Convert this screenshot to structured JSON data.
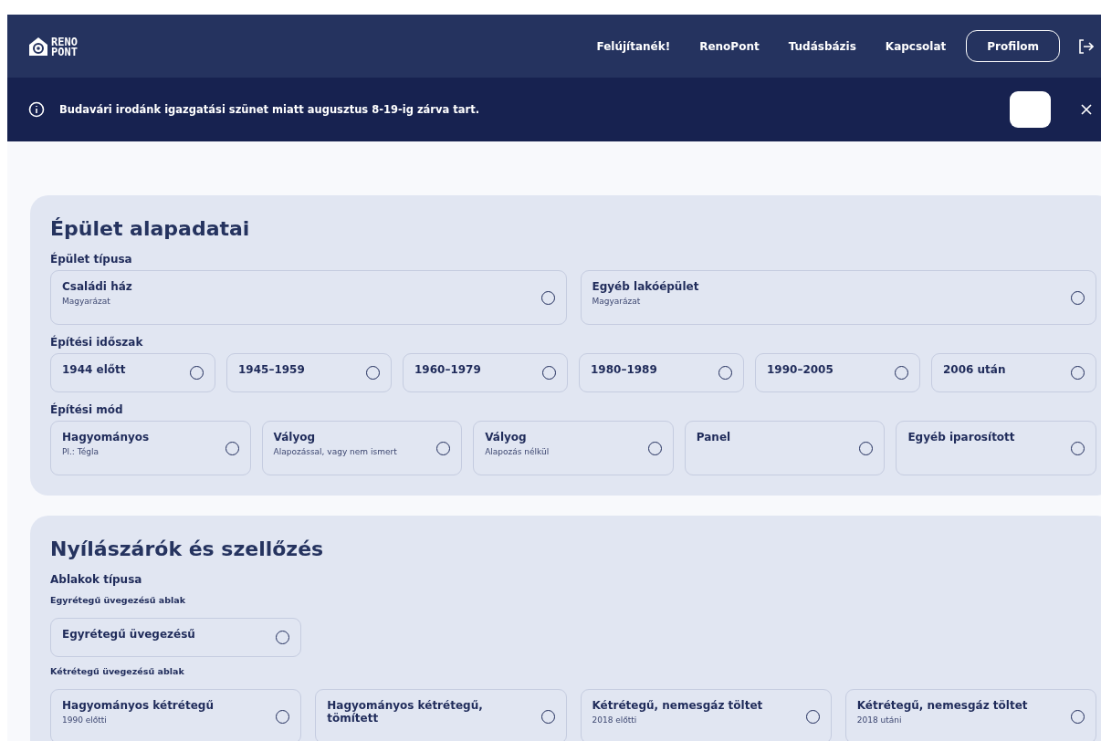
{
  "header": {
    "logo": [
      "RENO",
      "PONT"
    ],
    "nav": [
      "Felújítanék!",
      "RenoPont",
      "Tudásbázis",
      "Kapcsolat"
    ],
    "profile_button": "Profilom"
  },
  "banner": {
    "text": "Budavári irodánk igazgatási szünet miatt augusztus 8-19-ig zárva tart."
  },
  "sections": [
    {
      "title": "Épület alapadatai",
      "groups": [
        {
          "label": "Épület típusa",
          "options": [
            {
              "label": "Családi ház",
              "hint": "Magyarázat",
              "selected": false
            },
            {
              "label": "Egyéb lakóépület",
              "hint": "Magyarázat",
              "selected": false
            }
          ]
        },
        {
          "label": "Építési időszak",
          "options": [
            {
              "label": "1944 előtt",
              "selected": false
            },
            {
              "label": "1945–1959",
              "selected": false
            },
            {
              "label": "1960–1979",
              "selected": false
            },
            {
              "label": "1980–1989",
              "selected": false
            },
            {
              "label": "1990–2005",
              "selected": false
            },
            {
              "label": "2006 után",
              "selected": false
            }
          ]
        },
        {
          "label": "Építési mód",
          "options": [
            {
              "label": "Hagyományos",
              "hint": "Pl.: Tégla",
              "selected": false
            },
            {
              "label": "Vályog",
              "hint": "Alapozással, vagy nem ismert",
              "selected": false
            },
            {
              "label": "Vályog",
              "hint": "Alapozás nélkül",
              "selected": false
            },
            {
              "label": "Panel",
              "selected": false
            },
            {
              "label": "Egyéb iparosított",
              "selected": false
            }
          ]
        }
      ]
    },
    {
      "title": "Nyílászárók és szellőzés",
      "subtitle": "Ablakok típusa",
      "groups": [
        {
          "label": "Egyrétegű üvegezésű ablak",
          "options": [
            {
              "label": "Egyrétegű üvegezésű",
              "selected": false
            }
          ]
        },
        {
          "label": "Kétrétegű üvegezésű ablak",
          "options": [
            {
              "label": "Hagyományos kétrétegű",
              "hint": "1990 előtti",
              "selected": false
            },
            {
              "label": "Hagyományos kétrétegű, tömített",
              "selected": false
            },
            {
              "label": "Kétrétegű, nemesgáz töltet",
              "hint": "2018 előtti",
              "selected": false
            },
            {
              "label": "Kétrétegű, nemesgáz töltet",
              "hint": "2018 utáni",
              "selected": false
            }
          ]
        }
      ]
    }
  ]
}
